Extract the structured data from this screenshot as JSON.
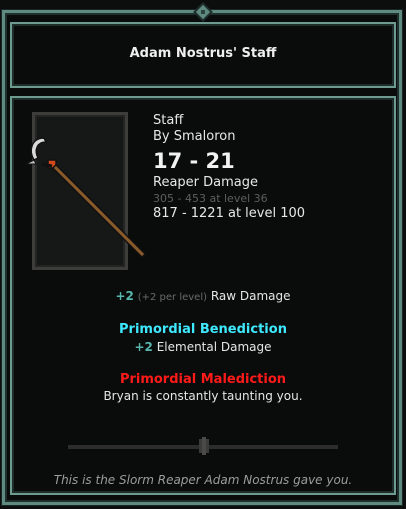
{
  "tooltip": {
    "title": "Adam Nostrus' Staff",
    "item_type": "Staff",
    "author": "By Smaloron",
    "damage_range": "17 - 21",
    "damage_type": "Reaper Damage",
    "level_36_range": "305 - 453 at level 36",
    "level_100_range": "817 - 1221 at level 100",
    "stat": {
      "value": "+2",
      "per_level": "(+2 per level)",
      "name": "Raw Damage"
    },
    "benediction": {
      "title": "Primordial Benediction",
      "value": "+2",
      "text": "Elemental Damage"
    },
    "malediction": {
      "title": "Primordial Malediction",
      "text": "Bryan is constantly taunting you."
    },
    "flavor_text": "This is the Slorm Reaper Adam Nostrus gave you.",
    "icon": "staff-icon"
  },
  "colors": {
    "frame": "#6d9b90",
    "benediction": "#3ee8ff",
    "malediction": "#ff1a1a",
    "stat_value": "#58b7ad"
  }
}
